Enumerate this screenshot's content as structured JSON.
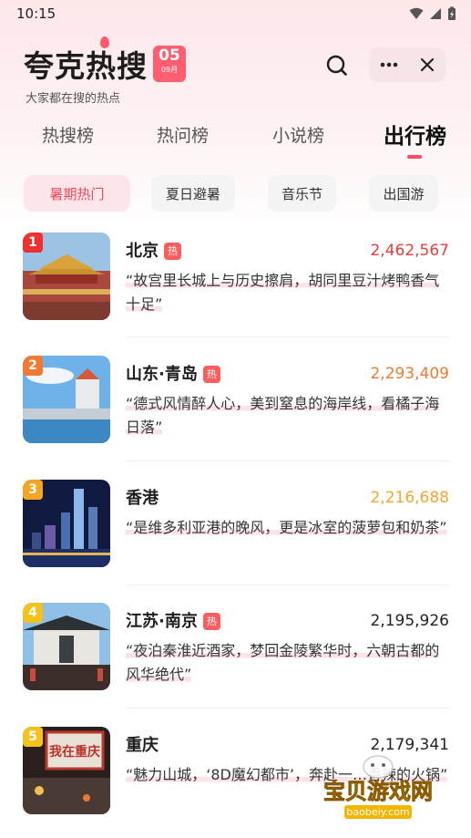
{
  "status_bar": {
    "time": "10:15"
  },
  "header": {
    "title": "夸克热搜",
    "date_day": "05",
    "date_month": "09月",
    "subtitle": "大家都在搜的热点"
  },
  "tabs": [
    {
      "label": "热搜榜"
    },
    {
      "label": "热问榜"
    },
    {
      "label": "小说榜"
    },
    {
      "label": "出行榜"
    }
  ],
  "chips": [
    {
      "label": "暑期热门"
    },
    {
      "label": "夏日避暑"
    },
    {
      "label": "音乐节"
    },
    {
      "label": "出国游"
    }
  ],
  "list": [
    {
      "rank": "1",
      "name": "北京",
      "tag": "热",
      "count": "2,462,567",
      "quote": "“故宫里长城上与历史擦肩，胡同里豆汁烤鸭香气十足”"
    },
    {
      "rank": "2",
      "name": "山东·青岛",
      "tag": "热",
      "count": "2,293,409",
      "quote": "“德式风情醉人心，美到窒息的海岸线，看橘子海日落”"
    },
    {
      "rank": "3",
      "name": "香港",
      "tag": "",
      "count": "2,216,688",
      "quote": "“是维多利亚港的晚风，更是冰室的菠萝包和奶茶”"
    },
    {
      "rank": "4",
      "name": "江苏·南京",
      "tag": "热",
      "count": "2,195,926",
      "quote": "“夜泊秦淮近酒家，梦回金陵繁华时，六朝古都的风华绝代”"
    },
    {
      "rank": "5",
      "name": "重庆",
      "tag": "",
      "count": "2,179,341",
      "quote": "“魅力山城，‘8D魔幻都市’，奔赴一…香辣的火锅”",
      "sign_text": "我在重庆"
    }
  ],
  "watermark": {
    "text": "宝贝游戏网",
    "url": "baobeiy.com"
  },
  "colors": {
    "accent": "#ff4b5e",
    "rank1": "#f0302f",
    "rank2": "#f2792f",
    "rank3": "#f5a623",
    "rank_other": "#f5c21b",
    "count1": "#ec3b3b",
    "count2": "#f07a32",
    "count3": "#f3a630",
    "count_other": "#222222"
  }
}
